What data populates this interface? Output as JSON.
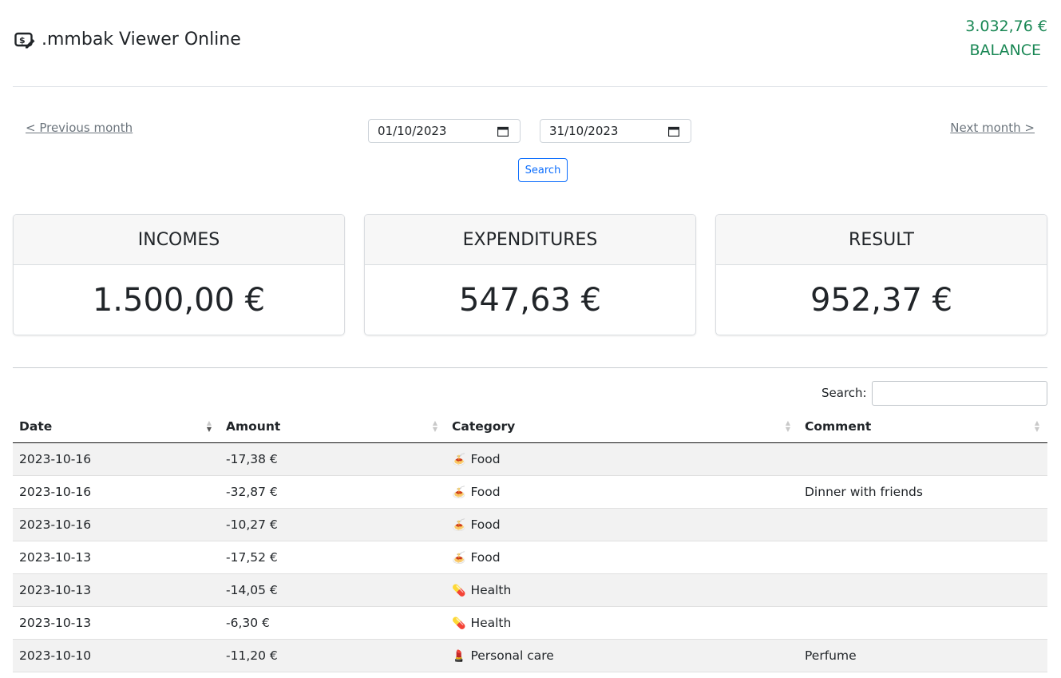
{
  "app": {
    "title": ".mmbak Viewer Online",
    "icon": "money-edit-icon"
  },
  "balance": {
    "amount": "3.032,76 €",
    "label": "BALANCE",
    "color": "#198754"
  },
  "nav": {
    "prev_label": "< Previous month",
    "next_label": "Next month >",
    "from_date": "01/10/2023",
    "to_date": "31/10/2023",
    "search_label": "Search"
  },
  "cards": {
    "incomes": {
      "title": "INCOMES",
      "value": "1.500,00 €"
    },
    "expenditures": {
      "title": "EXPENDITURES",
      "value": "547,63 €"
    },
    "result": {
      "title": "RESULT",
      "value": "952,37 €"
    }
  },
  "table": {
    "search_label": "Search:",
    "search_value": "",
    "columns": [
      "Date",
      "Amount",
      "Category",
      "Comment"
    ],
    "sorted_column": "Date",
    "sort_direction": "descending",
    "rows": [
      {
        "date": "2023-10-16",
        "amount": "-17,38 €",
        "category_icon": "🍝",
        "category": "Food",
        "comment": ""
      },
      {
        "date": "2023-10-16",
        "amount": "-32,87 €",
        "category_icon": "🍝",
        "category": "Food",
        "comment": "Dinner with friends"
      },
      {
        "date": "2023-10-16",
        "amount": "-10,27 €",
        "category_icon": "🍝",
        "category": "Food",
        "comment": ""
      },
      {
        "date": "2023-10-13",
        "amount": "-17,52 €",
        "category_icon": "🍝",
        "category": "Food",
        "comment": ""
      },
      {
        "date": "2023-10-13",
        "amount": "-14,05 €",
        "category_icon": "💊",
        "category": "Health",
        "comment": ""
      },
      {
        "date": "2023-10-13",
        "amount": "-6,30 €",
        "category_icon": "💊",
        "category": "Health",
        "comment": ""
      },
      {
        "date": "2023-10-10",
        "amount": "-11,20 €",
        "category_icon": "💄",
        "category": "Personal care",
        "comment": "Perfume"
      }
    ]
  }
}
